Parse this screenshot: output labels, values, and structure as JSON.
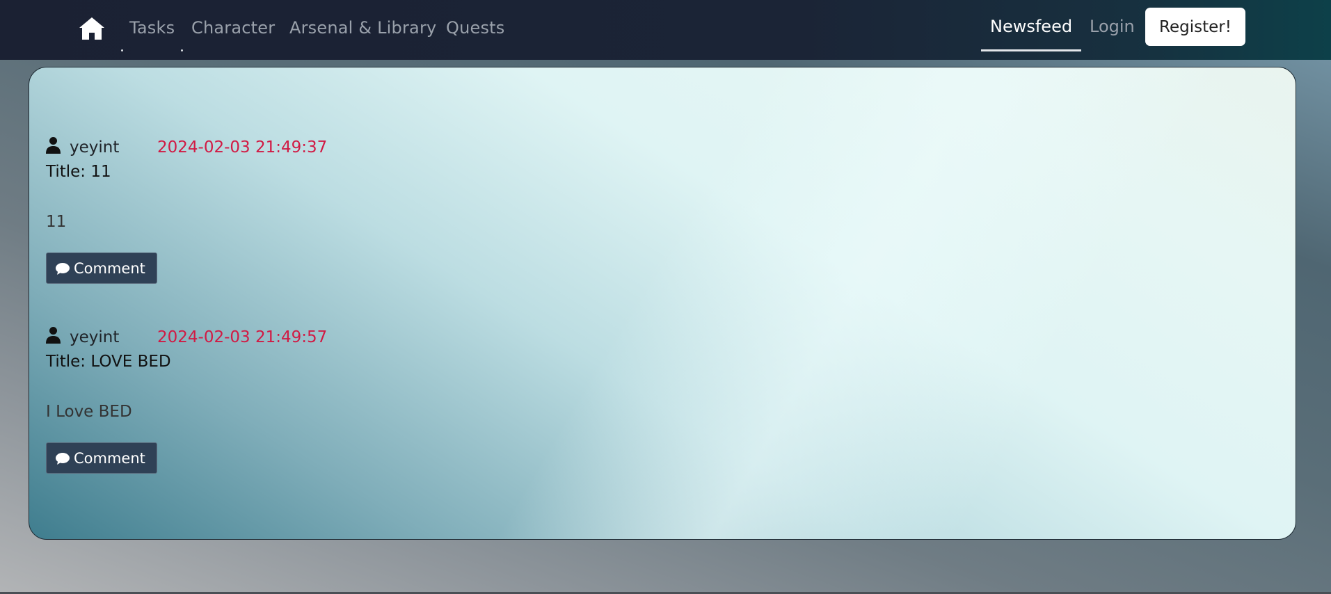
{
  "nav": {
    "home_icon": "home-icon",
    "links": [
      {
        "label": "Tasks"
      },
      {
        "label": "Character"
      },
      {
        "label": "Arsenal & Library"
      },
      {
        "label": "Quests"
      }
    ],
    "right": {
      "newsfeed": "Newsfeed",
      "login": "Login",
      "register": "Register!"
    }
  },
  "colors": {
    "navbar_bg": "#1b2133",
    "timestamp": "#d11a44",
    "comment_button": "#2f4156"
  },
  "posts": [
    {
      "user_icon": "user-icon",
      "username": "yeyint",
      "timestamp": "2024-02-03 21:49:37",
      "title": "Title: 11",
      "body": "11",
      "comment_icon": "comment-icon",
      "comment_label": "Comment"
    },
    {
      "user_icon": "user-icon",
      "username": "yeyint",
      "timestamp": "2024-02-03 21:49:57",
      "title": "Title: LOVE BED",
      "body": "I Love BED",
      "comment_icon": "comment-icon",
      "comment_label": "Comment"
    }
  ]
}
